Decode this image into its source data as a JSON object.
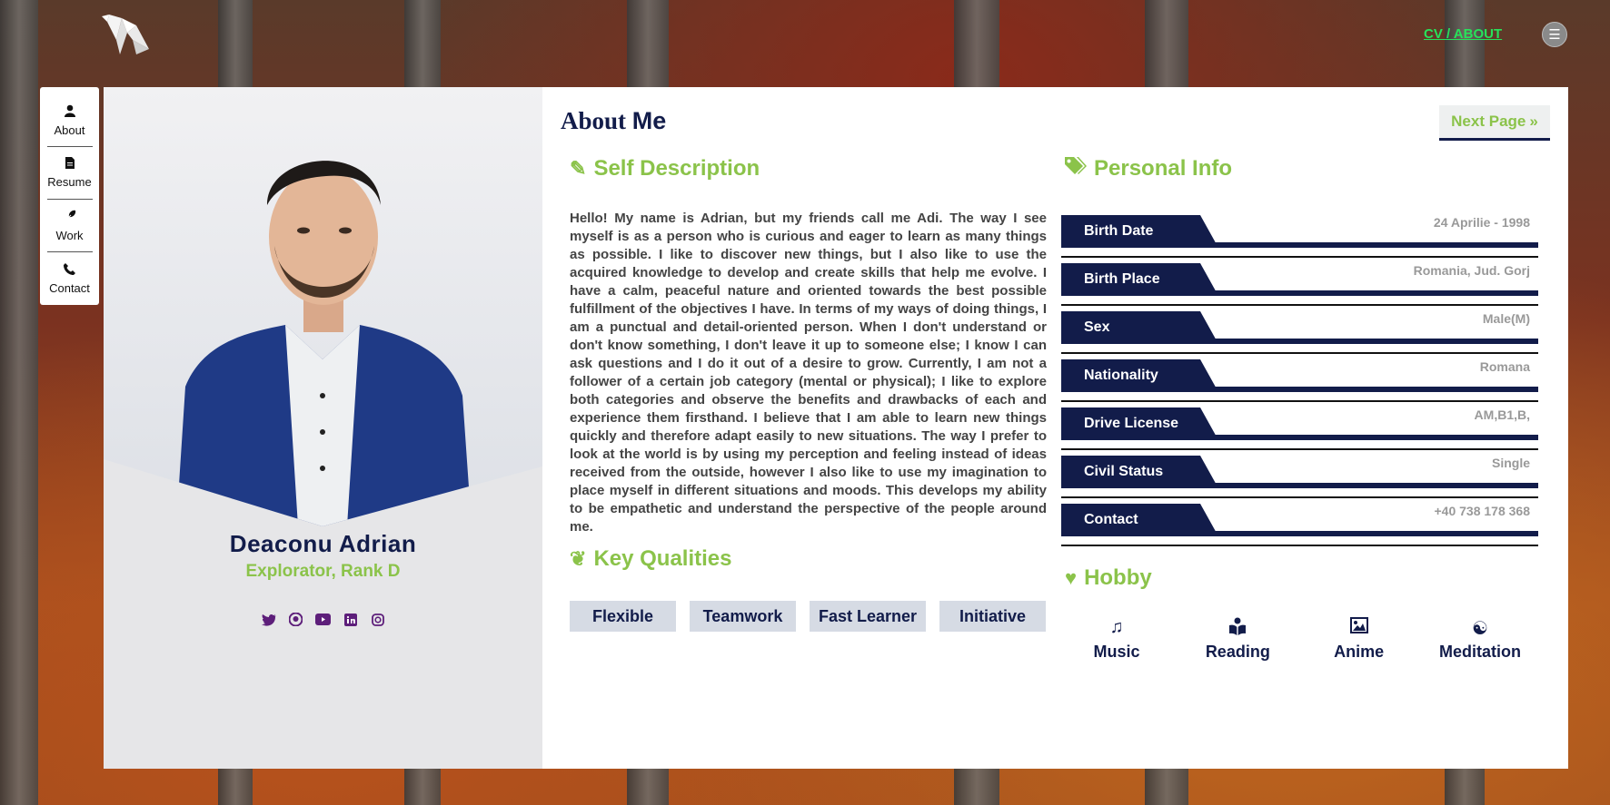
{
  "header": {
    "logo_icon": "origami-horse-logo",
    "nav_link": "CV / ABOUT",
    "menu_icon": "hamburger-icon",
    "menu_glyph": "☰"
  },
  "side_nav": [
    {
      "label": "About",
      "icon": "user-icon",
      "glyph": "👤"
    },
    {
      "label": "Resume",
      "icon": "document-icon",
      "glyph": "📄"
    },
    {
      "label": "Work",
      "icon": "feather-icon",
      "glyph": "✒"
    },
    {
      "label": "Contact",
      "icon": "phone-icon",
      "glyph": "☎"
    }
  ],
  "profile": {
    "name": "Deaconu Adrian",
    "rank": "Explorator, Rank D",
    "socials": [
      {
        "icon": "twitter-icon",
        "glyph": "🐦"
      },
      {
        "icon": "github-icon",
        "glyph": "◉"
      },
      {
        "icon": "youtube-icon",
        "glyph": "▶"
      },
      {
        "icon": "linkedin-icon",
        "glyph": "in"
      },
      {
        "icon": "instagram-icon",
        "glyph": "◎"
      }
    ]
  },
  "main": {
    "title_light": "About",
    "title_bold": "Me",
    "next_button": "Next Page",
    "next_glyph": "»",
    "self_description": {
      "title": "Self Description",
      "icon": "pencil-icon",
      "glyph": "✎",
      "text": "Hello! My name is Adrian, but my friends call me Adi. The way I see myself is as a person who is curious and eager to learn as many things as possible. I like to discover new things, but I also like to use the acquired knowledge to develop and create skills that help me evolve. I have a calm, peaceful nature and oriented towards the best possible fulfillment of the objectives I have. In terms of my ways of doing things, I am a punctual and detail-oriented person. When I don't understand or don't know something, I don't leave it up to someone else; I know I can ask questions and I do it out of a desire to grow. Currently, I am not a follower of a certain job category (mental or physical); I like to explore both categories and observe the benefits and drawbacks of each and experience them firsthand. I believe that I am able to learn new things quickly and therefore adapt easily to new situations. The way I prefer to look at the world is by using my perception and feeling instead of ideas received from the outside, however I also like to use my imagination to place myself in different situations and moods. This develops my ability to be empathetic and understand the perspective of the people around me."
    },
    "key_qualities": {
      "title": "Key Qualities",
      "icon": "leaf-icon",
      "glyph": "❦",
      "items": [
        "Flexible",
        "Teamwork",
        "Fast Learner",
        "Initiative"
      ]
    },
    "personal_info": {
      "title": "Personal Info",
      "icon": "tags-icon",
      "glyph": "🏷",
      "rows": [
        {
          "label": "Birth Date",
          "value": "24 Aprilie - 1998"
        },
        {
          "label": "Birth Place",
          "value": "Romania, Jud. Gorj"
        },
        {
          "label": "Sex",
          "value": "Male(M)"
        },
        {
          "label": "Nationality",
          "value": "Romana"
        },
        {
          "label": "Drive License",
          "value": "AM,B1,B,"
        },
        {
          "label": "Civil Status",
          "value": "Single"
        },
        {
          "label": "Contact",
          "value": "+40 738 178 368"
        }
      ]
    },
    "hobby": {
      "title": "Hobby",
      "icon": "heart-icon",
      "glyph": "♥",
      "items": [
        {
          "label": "Music",
          "icon": "music-note-icon",
          "glyph": "♫"
        },
        {
          "label": "Reading",
          "icon": "book-reader-icon",
          "glyph": "📖"
        },
        {
          "label": "Anime",
          "icon": "image-icon",
          "glyph": "🖼"
        },
        {
          "label": "Meditation",
          "icon": "yin-yang-icon",
          "glyph": "☯"
        }
      ]
    }
  },
  "colors": {
    "navy": "#121c4a",
    "green": "#8bc34a",
    "link_green": "#27e25a",
    "social_purple": "#5d1e7a"
  }
}
